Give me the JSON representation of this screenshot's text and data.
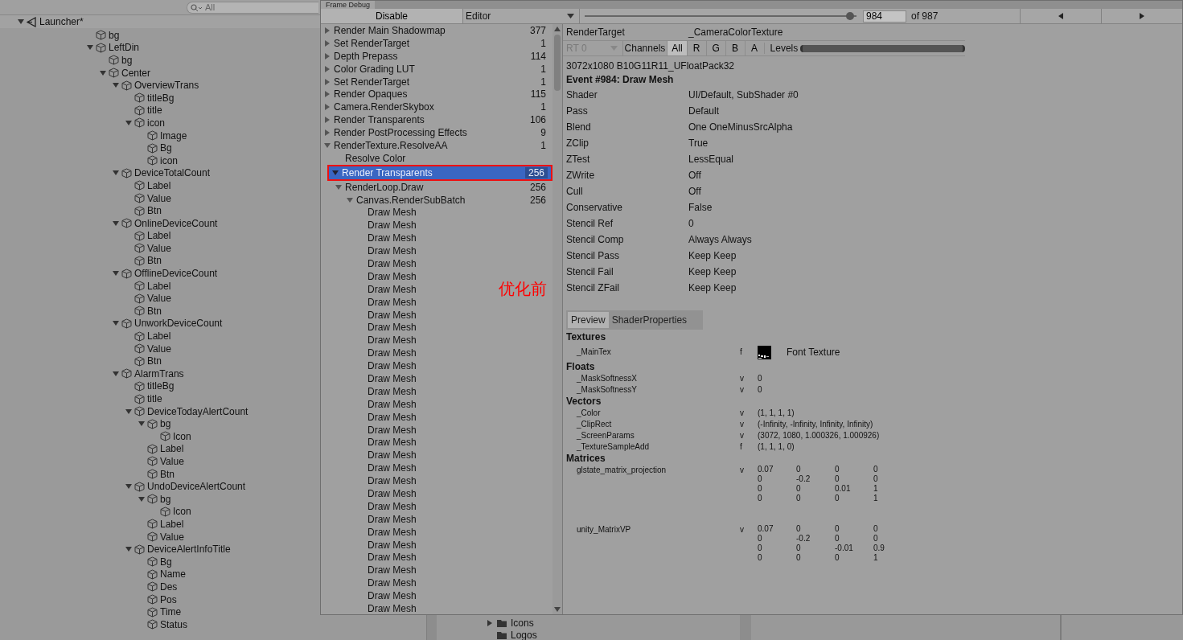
{
  "hierarchy": {
    "search": {
      "placeholder": "All"
    },
    "items": [
      {
        "label": "Launcher*",
        "kind": "scene",
        "expanded": true,
        "children": [
          {
            "label": "bg",
            "kind": "object"
          },
          {
            "label": "LeftDin",
            "kind": "object",
            "expanded": true,
            "children": [
              {
                "label": "bg",
                "kind": "object"
              },
              {
                "label": "Center",
                "kind": "object",
                "expanded": true,
                "children": [
                  {
                    "label": "OverviewTrans",
                    "kind": "object",
                    "expanded": true,
                    "children": [
                      {
                        "label": "titleBg",
                        "kind": "object"
                      },
                      {
                        "label": "title",
                        "kind": "object"
                      },
                      {
                        "label": "icon",
                        "kind": "object",
                        "expanded": true,
                        "children": [
                          {
                            "label": "Image",
                            "kind": "object"
                          },
                          {
                            "label": "Bg",
                            "kind": "object"
                          },
                          {
                            "label": "icon",
                            "kind": "object"
                          }
                        ]
                      }
                    ]
                  },
                  {
                    "label": "DeviceTotalCount",
                    "kind": "object",
                    "expanded": true,
                    "children": [
                      {
                        "label": "Label",
                        "kind": "object"
                      },
                      {
                        "label": "Value",
                        "kind": "object"
                      },
                      {
                        "label": "Btn",
                        "kind": "object"
                      }
                    ]
                  },
                  {
                    "label": "OnlineDeviceCount",
                    "kind": "object",
                    "expanded": true,
                    "children": [
                      {
                        "label": "Label",
                        "kind": "object"
                      },
                      {
                        "label": "Value",
                        "kind": "object"
                      },
                      {
                        "label": "Btn",
                        "kind": "object"
                      }
                    ]
                  },
                  {
                    "label": "OfflineDeviceCount",
                    "kind": "object",
                    "expanded": true,
                    "children": [
                      {
                        "label": "Label",
                        "kind": "object"
                      },
                      {
                        "label": "Value",
                        "kind": "object"
                      },
                      {
                        "label": "Btn",
                        "kind": "object"
                      }
                    ]
                  },
                  {
                    "label": "UnworkDeviceCount",
                    "kind": "object",
                    "expanded": true,
                    "children": [
                      {
                        "label": "Label",
                        "kind": "object"
                      },
                      {
                        "label": "Value",
                        "kind": "object"
                      },
                      {
                        "label": "Btn",
                        "kind": "object"
                      }
                    ]
                  },
                  {
                    "label": "AlarmTrans",
                    "kind": "object",
                    "expanded": true,
                    "children": [
                      {
                        "label": "titleBg",
                        "kind": "object"
                      },
                      {
                        "label": "title",
                        "kind": "object"
                      },
                      {
                        "label": "DeviceTodayAlertCount",
                        "kind": "object",
                        "expanded": true,
                        "children": [
                          {
                            "label": "bg",
                            "kind": "object",
                            "expanded": true,
                            "children": [
                              {
                                "label": "Icon",
                                "kind": "object"
                              }
                            ]
                          },
                          {
                            "label": "Label",
                            "kind": "object"
                          },
                          {
                            "label": "Value",
                            "kind": "object"
                          },
                          {
                            "label": "Btn",
                            "kind": "object"
                          }
                        ]
                      },
                      {
                        "label": "UndoDeviceAlertCount",
                        "kind": "object",
                        "expanded": true,
                        "children": [
                          {
                            "label": "bg",
                            "kind": "object",
                            "expanded": true,
                            "children": [
                              {
                                "label": "Icon",
                                "kind": "object"
                              }
                            ]
                          },
                          {
                            "label": "Label",
                            "kind": "object"
                          },
                          {
                            "label": "Value",
                            "kind": "object"
                          }
                        ]
                      },
                      {
                        "label": "DeviceAlertInfoTitle",
                        "kind": "object",
                        "expanded": true,
                        "children": [
                          {
                            "label": "Bg",
                            "kind": "object"
                          },
                          {
                            "label": "Name",
                            "kind": "object"
                          },
                          {
                            "label": "Des",
                            "kind": "object"
                          },
                          {
                            "label": "Pos",
                            "kind": "object"
                          },
                          {
                            "label": "Time",
                            "kind": "object"
                          },
                          {
                            "label": "Status",
                            "kind": "object"
                          }
                        ]
                      }
                    ]
                  }
                ]
              }
            ]
          }
        ]
      }
    ]
  },
  "project": {
    "items": [
      {
        "label": "Icons",
        "expanded": false
      },
      {
        "label": "Logos"
      }
    ]
  },
  "frame_debug": {
    "title": "Frame Debug",
    "toolbar": {
      "toggle": "Disable",
      "target": "Editor",
      "level": 0.99,
      "event": "984",
      "event_total": "of 987"
    },
    "events": [
      {
        "label": "Render Main Shadowmap",
        "count": "377",
        "expanded": false,
        "selected": false
      },
      {
        "label": "Set RenderTarget",
        "count": "1",
        "expanded": false,
        "selected": false
      },
      {
        "label": "Depth Prepass",
        "count": "114",
        "expanded": false,
        "selected": false
      },
      {
        "label": "Color Grading LUT",
        "count": "1",
        "expanded": false,
        "selected": false
      },
      {
        "label": "Set RenderTarget",
        "count": "1",
        "expanded": false,
        "selected": false
      },
      {
        "label": "Render Opaques",
        "count": "115",
        "expanded": false,
        "selected": false
      },
      {
        "label": "Camera.RenderSkybox",
        "count": "1",
        "expanded": false,
        "selected": false
      },
      {
        "label": "Render Transparents",
        "count": "106",
        "expanded": false,
        "selected": false
      },
      {
        "label": "Render PostProcessing Effects",
        "count": "9",
        "expanded": false,
        "selected": false
      },
      {
        "label": "RenderTexture.ResolveAA",
        "count": "1",
        "expanded": true,
        "selected": false,
        "children": [
          {
            "label": "Resolve Color",
            "selected": false
          }
        ]
      },
      {
        "label": "Render Transparents",
        "count": "256",
        "expanded": true,
        "selected": true,
        "children": [
          {
            "label": "RenderLoop.Draw",
            "count": "256",
            "expanded": true,
            "selected": false,
            "children": [
              {
                "label": "Canvas.RenderSubBatch",
                "count": "256",
                "expanded": true,
                "selected": false,
                "children": [
                  {
                    "label": "Draw Mesh",
                    "selected": false
                  },
                  {
                    "label": "Draw Mesh",
                    "selected": false
                  },
                  {
                    "label": "Draw Mesh",
                    "selected": false
                  },
                  {
                    "label": "Draw Mesh",
                    "selected": false
                  },
                  {
                    "label": "Draw Mesh",
                    "selected": false
                  },
                  {
                    "label": "Draw Mesh",
                    "selected": false
                  },
                  {
                    "label": "Draw Mesh",
                    "selected": false
                  },
                  {
                    "label": "Draw Mesh",
                    "selected": false
                  },
                  {
                    "label": "Draw Mesh",
                    "selected": false
                  },
                  {
                    "label": "Draw Mesh",
                    "selected": false
                  },
                  {
                    "label": "Draw Mesh",
                    "selected": false
                  },
                  {
                    "label": "Draw Mesh",
                    "selected": false
                  },
                  {
                    "label": "Draw Mesh",
                    "selected": false
                  },
                  {
                    "label": "Draw Mesh",
                    "selected": false
                  },
                  {
                    "label": "Draw Mesh",
                    "selected": false
                  },
                  {
                    "label": "Draw Mesh",
                    "selected": false
                  },
                  {
                    "label": "Draw Mesh",
                    "selected": false
                  },
                  {
                    "label": "Draw Mesh",
                    "selected": false
                  },
                  {
                    "label": "Draw Mesh",
                    "selected": false
                  },
                  {
                    "label": "Draw Mesh",
                    "selected": false
                  },
                  {
                    "label": "Draw Mesh",
                    "selected": false
                  },
                  {
                    "label": "Draw Mesh",
                    "selected": false
                  },
                  {
                    "label": "Draw Mesh",
                    "selected": false
                  },
                  {
                    "label": "Draw Mesh",
                    "selected": false
                  },
                  {
                    "label": "Draw Mesh",
                    "selected": false
                  },
                  {
                    "label": "Draw Mesh",
                    "selected": false
                  },
                  {
                    "label": "Draw Mesh",
                    "selected": false
                  },
                  {
                    "label": "Draw Mesh",
                    "selected": false
                  },
                  {
                    "label": "Draw Mesh",
                    "selected": false
                  },
                  {
                    "label": "Draw Mesh",
                    "selected": false
                  },
                  {
                    "label": "Draw Mesh",
                    "selected": false
                  },
                  {
                    "label": "Draw Mesh",
                    "selected": false
                  }
                ]
              }
            ]
          }
        ]
      }
    ],
    "details": {
      "render_target": {
        "label": "RenderTarget",
        "value": "_CameraColorTexture"
      },
      "rt": {
        "value": "RT 0",
        "disabled": true
      },
      "channels": {
        "label": "Channels",
        "options": [
          {
            "label": "All",
            "selected": true
          },
          {
            "label": "R",
            "selected": false
          },
          {
            "label": "G",
            "selected": false
          },
          {
            "label": "B",
            "selected": false
          },
          {
            "label": "A",
            "selected": false
          }
        ]
      },
      "levels": {
        "label": "Levels"
      },
      "format": "3072x1080 B10G11R11_UFloatPack32",
      "event_title": "Event #984: Draw Mesh",
      "properties": [
        {
          "label": "Shader",
          "value": "UI/Default, SubShader #0"
        },
        {
          "label": "Pass",
          "value": "Default"
        },
        {
          "label": "Blend",
          "value": "One OneMinusSrcAlpha"
        },
        {
          "label": "ZClip",
          "value": "True"
        },
        {
          "label": "ZTest",
          "value": "LessEqual"
        },
        {
          "label": "ZWrite",
          "value": "Off"
        },
        {
          "label": "Cull",
          "value": "Off"
        },
        {
          "label": "Conservative",
          "value": "False"
        },
        {
          "label": "Stencil Ref",
          "value": "0"
        },
        {
          "label": "Stencil Comp",
          "value": "Always Always"
        },
        {
          "label": "Stencil Pass",
          "value": "Keep Keep"
        },
        {
          "label": "Stencil Fail",
          "value": "Keep Keep"
        },
        {
          "label": "Stencil ZFail",
          "value": "Keep Keep"
        }
      ],
      "tabs": [
        {
          "label": "Preview",
          "selected": true
        },
        {
          "label": "ShaderProperties",
          "selected": false
        }
      ],
      "sections": [
        {
          "title": "Textures",
          "rows": [
            {
              "name": "_MainTex",
              "type": "f",
              "kind": "texture",
              "value": "Font Texture"
            }
          ]
        },
        {
          "title": "Floats",
          "rows": [
            {
              "name": "_MaskSoftnessX",
              "type": "v",
              "kind": "text",
              "value": "0"
            },
            {
              "name": "_MaskSoftnessY",
              "type": "v",
              "kind": "text",
              "value": "0"
            }
          ]
        },
        {
          "title": "Vectors",
          "rows": [
            {
              "name": "_Color",
              "type": "v",
              "kind": "text",
              "value": "(1, 1, 1, 1)"
            },
            {
              "name": "_ClipRect",
              "type": "v",
              "kind": "text",
              "value": "(-Infinity, -Infinity, Infinity, Infinity)"
            },
            {
              "name": "_ScreenParams",
              "type": "v",
              "kind": "text",
              "value": "(3072, 1080, 1.000326, 1.000926)"
            },
            {
              "name": "_TextureSampleAdd",
              "type": "f",
              "kind": "text",
              "value": "(1, 1, 1, 0)"
            }
          ]
        },
        {
          "title": "Matrices",
          "rows": [
            {
              "name": "glstate_matrix_projection",
              "type": "v",
              "kind": "matrix",
              "matrix": [
                [
                  "0.07",
                  "0",
                  "0",
                  "0"
                ],
                [
                  "0",
                  "-0.2",
                  "0",
                  "0"
                ],
                [
                  "0",
                  "0",
                  "0.01",
                  "1"
                ],
                [
                  "0",
                  "0",
                  "0",
                  "1"
                ]
              ]
            },
            {
              "name": "unity_MatrixVP",
              "type": "v",
              "kind": "matrix",
              "matrix": [
                [
                  "0.07",
                  "0",
                  "0",
                  "0"
                ],
                [
                  "0",
                  "-0.2",
                  "0",
                  "0"
                ],
                [
                  "0",
                  "0",
                  "-0.01",
                  "0.9"
                ],
                [
                  "0",
                  "0",
                  "0",
                  "1"
                ]
              ]
            }
          ]
        }
      ]
    }
  },
  "annotation": {
    "label": "优化前"
  }
}
